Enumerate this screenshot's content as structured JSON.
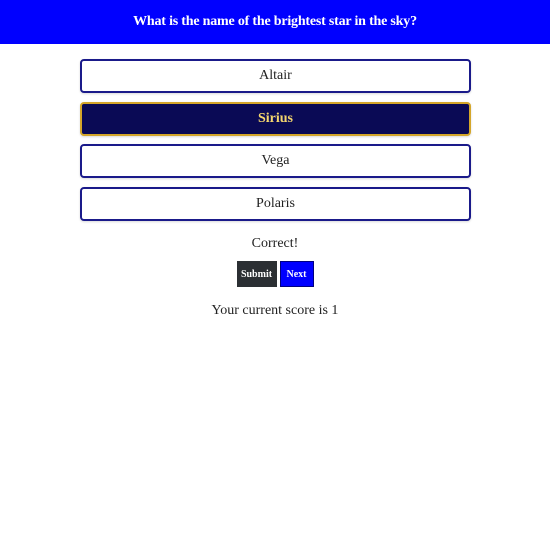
{
  "question": "What is the name of the brightest star in the sky?",
  "options": [
    {
      "label": "Altair",
      "selected": false
    },
    {
      "label": "Sirius",
      "selected": true
    },
    {
      "label": "Vega",
      "selected": false
    },
    {
      "label": "Polaris",
      "selected": false
    }
  ],
  "feedback": "Correct!",
  "buttons": {
    "submit_label": "Submit",
    "next_label": "Next"
  },
  "score_text": "Your current score is 1",
  "colors": {
    "header_bg": "#0000ff",
    "selected_bg": "#0a0a55",
    "selected_text": "#f5d76e",
    "submit_bg": "#2b2f33",
    "next_bg": "#0000ff"
  }
}
